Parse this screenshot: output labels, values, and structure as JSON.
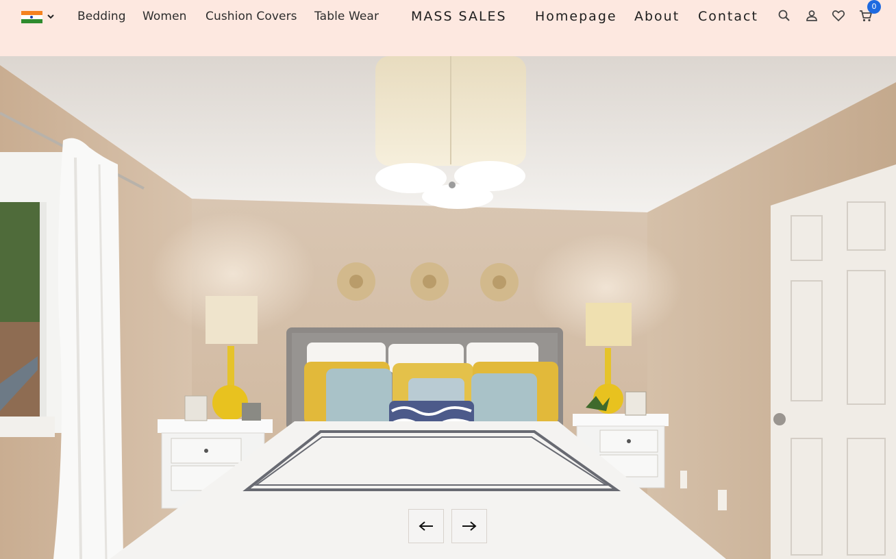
{
  "header": {
    "country_flag": "india-flag-icon",
    "nav_left": [
      "Bedding",
      "Women",
      "Cushion Covers",
      "Table Wear"
    ],
    "brand": "MASS SALES",
    "nav_right": [
      "Homepage",
      "About",
      "Contact"
    ],
    "icons": [
      "search-icon",
      "user-icon",
      "heart-icon",
      "cart-icon"
    ],
    "cart_count": "0"
  },
  "hero": {
    "image": "bedroom-photo",
    "prev_icon": "arrow-left-icon",
    "next_icon": "arrow-right-icon"
  },
  "colors": {
    "header_bg": "#fde8e0",
    "badge": "#1e6ae0"
  }
}
